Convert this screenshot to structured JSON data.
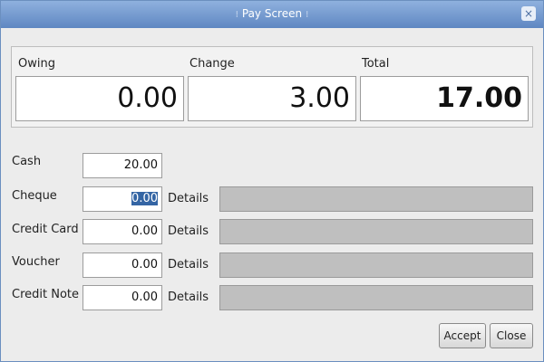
{
  "window": {
    "title": "Pay Screen",
    "close_glyph": "×"
  },
  "summary": {
    "owing": {
      "label": "Owing",
      "value": "0.00"
    },
    "change": {
      "label": "Change",
      "value": "3.00"
    },
    "total": {
      "label": "Total",
      "value": "17.00"
    }
  },
  "payments": {
    "cash": {
      "label": "Cash",
      "value": "20.00"
    },
    "cheque": {
      "label": "Cheque",
      "value": "0.00",
      "details_label": "Details"
    },
    "credit_card": {
      "label": "Credit Card",
      "value": "0.00",
      "details_label": "Details"
    },
    "voucher": {
      "label": "Voucher",
      "value": "0.00",
      "details_label": "Details"
    },
    "credit_note": {
      "label": "Credit Note",
      "value": "0.00",
      "details_label": "Details"
    }
  },
  "buttons": {
    "accept": "Accept",
    "close": "Close"
  },
  "colors": {
    "titlebar": "#5f87c2",
    "selection": "#3465a4"
  }
}
